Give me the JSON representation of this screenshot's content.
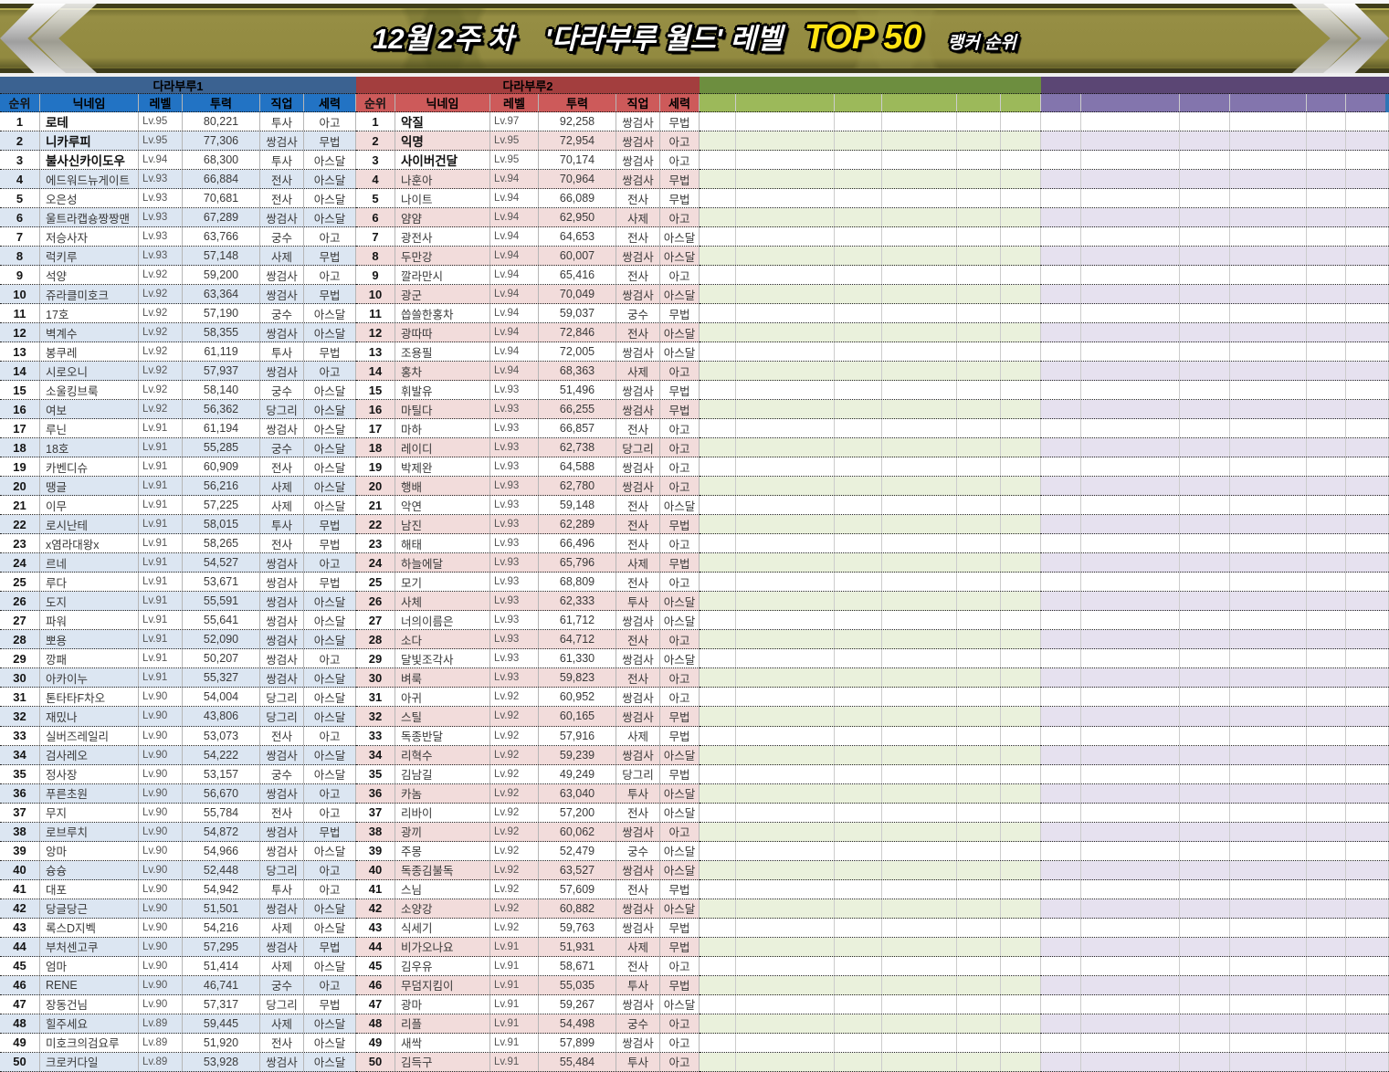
{
  "banner": {
    "week": "12월 2주 차",
    "world": "'다라부루 월드' 레벨",
    "top": "TOP 50",
    "suffix": "랭커 순위",
    "top_color": "#ffe312",
    "bar_color": "#928a40"
  },
  "columns": [
    "순위",
    "닉네임",
    "레벨",
    "투력",
    "직업",
    "세력"
  ],
  "tables": [
    {
      "name": "다라부루1",
      "title_bg": "#3b6291",
      "header_bg": "#2273c4",
      "stripe": "#dce6f2",
      "rows": [
        [
          "1",
          "로테",
          "Lv.95",
          "80,221",
          "투사",
          "아고"
        ],
        [
          "2",
          "니카루피",
          "Lv.95",
          "77,306",
          "쌍검사",
          "무법"
        ],
        [
          "3",
          "불사신카이도우",
          "Lv.94",
          "68,300",
          "투사",
          "아스달"
        ],
        [
          "4",
          "에드워드뉴게이트",
          "Lv.93",
          "66,884",
          "전사",
          "아스달"
        ],
        [
          "5",
          "오은성",
          "Lv.93",
          "70,681",
          "전사",
          "아스달"
        ],
        [
          "6",
          "울트라캡숑짱짱맨",
          "Lv.93",
          "67,289",
          "쌍검사",
          "아스달"
        ],
        [
          "7",
          "저승사자",
          "Lv.93",
          "63,766",
          "궁수",
          "아고"
        ],
        [
          "8",
          "럭키루",
          "Lv.93",
          "57,148",
          "사제",
          "무법"
        ],
        [
          "9",
          "석양",
          "Lv.92",
          "59,200",
          "쌍검사",
          "아고"
        ],
        [
          "10",
          "쥬라클미호크",
          "Lv.92",
          "63,364",
          "쌍검사",
          "무법"
        ],
        [
          "11",
          "17호",
          "Lv.92",
          "57,190",
          "궁수",
          "아스달"
        ],
        [
          "12",
          "벽계수",
          "Lv.92",
          "58,355",
          "쌍검사",
          "아스달"
        ],
        [
          "13",
          "봉쿠레",
          "Lv.92",
          "61,119",
          "투사",
          "무법"
        ],
        [
          "14",
          "시로오니",
          "Lv.92",
          "57,937",
          "쌍검사",
          "아고"
        ],
        [
          "15",
          "소울킹브룩",
          "Lv.92",
          "58,140",
          "궁수",
          "아스달"
        ],
        [
          "16",
          "여보",
          "Lv.92",
          "56,362",
          "당그리",
          "아스달"
        ],
        [
          "17",
          "루닌",
          "Lv.91",
          "61,194",
          "쌍검사",
          "아스달"
        ],
        [
          "18",
          "18호",
          "Lv.91",
          "55,285",
          "궁수",
          "아스달"
        ],
        [
          "19",
          "카벤디슈",
          "Lv.91",
          "60,909",
          "전사",
          "아스달"
        ],
        [
          "20",
          "땡글",
          "Lv.91",
          "56,216",
          "사제",
          "아스달"
        ],
        [
          "21",
          "이무",
          "Lv.91",
          "57,225",
          "사제",
          "아스달"
        ],
        [
          "22",
          "로시난테",
          "Lv.91",
          "58,015",
          "투사",
          "무법"
        ],
        [
          "23",
          "x염라대왕x",
          "Lv.91",
          "58,265",
          "전사",
          "무법"
        ],
        [
          "24",
          "르네",
          "Lv.91",
          "54,527",
          "쌍검사",
          "아고"
        ],
        [
          "25",
          "루다",
          "Lv.91",
          "53,671",
          "쌍검사",
          "무법"
        ],
        [
          "26",
          "도지",
          "Lv.91",
          "55,591",
          "쌍검사",
          "아스달"
        ],
        [
          "27",
          "파워",
          "Lv.91",
          "55,641",
          "쌍검사",
          "아스달"
        ],
        [
          "28",
          "뽀용",
          "Lv.91",
          "52,090",
          "쌍검사",
          "아스달"
        ],
        [
          "29",
          "깡패",
          "Lv.91",
          "50,207",
          "쌍검사",
          "아고"
        ],
        [
          "30",
          "아카이누",
          "Lv.91",
          "55,327",
          "쌍검사",
          "아스달"
        ],
        [
          "31",
          "톤타타F차오",
          "Lv.90",
          "54,004",
          "당그리",
          "아스달"
        ],
        [
          "32",
          "재밌나",
          "Lv.90",
          "43,806",
          "당그리",
          "아스달"
        ],
        [
          "33",
          "실버즈레일리",
          "Lv.90",
          "53,073",
          "전사",
          "아고"
        ],
        [
          "34",
          "검사레오",
          "Lv.90",
          "54,222",
          "쌍검사",
          "아스달"
        ],
        [
          "35",
          "정사장",
          "Lv.90",
          "53,157",
          "궁수",
          "아스달"
        ],
        [
          "36",
          "푸른초원",
          "Lv.90",
          "56,670",
          "쌍검사",
          "아고"
        ],
        [
          "37",
          "무지",
          "Lv.90",
          "55,784",
          "전사",
          "아고"
        ],
        [
          "38",
          "로브루치",
          "Lv.90",
          "54,872",
          "쌍검사",
          "무법"
        ],
        [
          "39",
          "앙마",
          "Lv.90",
          "54,966",
          "쌍검사",
          "아스달"
        ],
        [
          "40",
          "슝슝",
          "Lv.90",
          "52,448",
          "당그리",
          "아고"
        ],
        [
          "41",
          "대포",
          "Lv.90",
          "54,942",
          "투사",
          "아고"
        ],
        [
          "42",
          "당글당근",
          "Lv.90",
          "51,501",
          "쌍검사",
          "아스달"
        ],
        [
          "43",
          "록스D지벡",
          "Lv.90",
          "54,216",
          "사제",
          "아스달"
        ],
        [
          "44",
          "부처센고쿠",
          "Lv.90",
          "57,295",
          "쌍검사",
          "무법"
        ],
        [
          "45",
          "엄마",
          "Lv.90",
          "51,414",
          "사제",
          "아스달"
        ],
        [
          "46",
          "RENE",
          "Lv.90",
          "46,741",
          "궁수",
          "아고"
        ],
        [
          "47",
          "장동건님",
          "Lv.90",
          "57,317",
          "당그리",
          "무법"
        ],
        [
          "48",
          "힐주세요",
          "Lv.89",
          "59,445",
          "사제",
          "아스달"
        ],
        [
          "49",
          "미호크의검요루",
          "Lv.89",
          "51,920",
          "전사",
          "아스달"
        ],
        [
          "50",
          "크로커다일",
          "Lv.89",
          "53,928",
          "쌍검사",
          "아스달"
        ]
      ]
    },
    {
      "name": "다라부루2",
      "title_bg": "#a33e3e",
      "header_bg": "#cd5a5a",
      "stripe": "#f2dcdb",
      "rows": [
        [
          "1",
          "악질",
          "Lv.97",
          "92,258",
          "쌍검사",
          "무법"
        ],
        [
          "2",
          "익명",
          "Lv.95",
          "72,954",
          "쌍검사",
          "아고"
        ],
        [
          "3",
          "사이버건달",
          "Lv.95",
          "70,174",
          "쌍검사",
          "아고"
        ],
        [
          "4",
          "나훈아",
          "Lv.94",
          "70,964",
          "쌍검사",
          "무법"
        ],
        [
          "5",
          "나이트",
          "Lv.94",
          "66,089",
          "전사",
          "무법"
        ],
        [
          "6",
          "얌얌",
          "Lv.94",
          "62,950",
          "사제",
          "아고"
        ],
        [
          "7",
          "광전사",
          "Lv.94",
          "64,653",
          "전사",
          "아스달"
        ],
        [
          "8",
          "두만강",
          "Lv.94",
          "60,007",
          "쌍검사",
          "아스달"
        ],
        [
          "9",
          "깔라만시",
          "Lv.94",
          "65,416",
          "전사",
          "아고"
        ],
        [
          "10",
          "광군",
          "Lv.94",
          "70,049",
          "쌍검사",
          "아스달"
        ],
        [
          "11",
          "씁쓸한홍차",
          "Lv.94",
          "59,037",
          "궁수",
          "무법"
        ],
        [
          "12",
          "광따따",
          "Lv.94",
          "72,846",
          "전사",
          "아스달"
        ],
        [
          "13",
          "조용필",
          "Lv.94",
          "72,005",
          "쌍검사",
          "아스달"
        ],
        [
          "14",
          "홍차",
          "Lv.94",
          "68,363",
          "사제",
          "아고"
        ],
        [
          "15",
          "휘발유",
          "Lv.93",
          "51,496",
          "쌍검사",
          "무법"
        ],
        [
          "16",
          "마틸다",
          "Lv.93",
          "66,255",
          "쌍검사",
          "무법"
        ],
        [
          "17",
          "마하",
          "Lv.93",
          "66,857",
          "전사",
          "아고"
        ],
        [
          "18",
          "레이디",
          "Lv.93",
          "62,738",
          "당그리",
          "아고"
        ],
        [
          "19",
          "박제완",
          "Lv.93",
          "64,588",
          "쌍검사",
          "아고"
        ],
        [
          "20",
          "행배",
          "Lv.93",
          "62,780",
          "쌍검사",
          "아고"
        ],
        [
          "21",
          "악연",
          "Lv.93",
          "59,148",
          "전사",
          "아스달"
        ],
        [
          "22",
          "남진",
          "Lv.93",
          "62,289",
          "전사",
          "무법"
        ],
        [
          "23",
          "해태",
          "Lv.93",
          "66,496",
          "전사",
          "아고"
        ],
        [
          "24",
          "하늘에달",
          "Lv.93",
          "65,796",
          "사제",
          "무법"
        ],
        [
          "25",
          "모기",
          "Lv.93",
          "68,809",
          "전사",
          "아고"
        ],
        [
          "26",
          "사체",
          "Lv.93",
          "62,333",
          "투사",
          "아스달"
        ],
        [
          "27",
          "너의이름은",
          "Lv.93",
          "61,712",
          "쌍검사",
          "아스달"
        ],
        [
          "28",
          "소다",
          "Lv.93",
          "64,712",
          "전사",
          "아고"
        ],
        [
          "29",
          "달빛조각사",
          "Lv.93",
          "61,330",
          "쌍검사",
          "아스달"
        ],
        [
          "30",
          "벼룩",
          "Lv.93",
          "59,823",
          "전사",
          "아고"
        ],
        [
          "31",
          "아귀",
          "Lv.92",
          "60,952",
          "쌍검사",
          "아고"
        ],
        [
          "32",
          "스틸",
          "Lv.92",
          "60,165",
          "쌍검사",
          "무법"
        ],
        [
          "33",
          "독종반달",
          "Lv.92",
          "57,916",
          "사제",
          "무법"
        ],
        [
          "34",
          "리혁수",
          "Lv.92",
          "59,239",
          "쌍검사",
          "아스달"
        ],
        [
          "35",
          "김남길",
          "Lv.92",
          "49,249",
          "당그리",
          "무법"
        ],
        [
          "36",
          "카놈",
          "Lv.92",
          "63,040",
          "투사",
          "아스달"
        ],
        [
          "37",
          "리바이",
          "Lv.92",
          "57,200",
          "전사",
          "아스달"
        ],
        [
          "38",
          "광끼",
          "Lv.92",
          "60,062",
          "쌍검사",
          "아고"
        ],
        [
          "39",
          "주몽",
          "Lv.92",
          "52,479",
          "궁수",
          "아스달"
        ],
        [
          "40",
          "독종김불독",
          "Lv.92",
          "63,527",
          "쌍검사",
          "아스달"
        ],
        [
          "41",
          "스님",
          "Lv.92",
          "57,609",
          "전사",
          "무법"
        ],
        [
          "42",
          "소양강",
          "Lv.92",
          "60,882",
          "쌍검사",
          "아스달"
        ],
        [
          "43",
          "식세기",
          "Lv.92",
          "59,763",
          "쌍검사",
          "무법"
        ],
        [
          "44",
          "비가오나요",
          "Lv.91",
          "51,931",
          "사제",
          "무법"
        ],
        [
          "45",
          "김우유",
          "Lv.91",
          "58,671",
          "전사",
          "아고"
        ],
        [
          "46",
          "무덤지킴이",
          "Lv.91",
          "55,035",
          "투사",
          "무법"
        ],
        [
          "47",
          "광마",
          "Lv.91",
          "59,267",
          "쌍검사",
          "아스달"
        ],
        [
          "48",
          "리플",
          "Lv.91",
          "54,498",
          "궁수",
          "아고"
        ],
        [
          "49",
          "새싹",
          "Lv.91",
          "57,899",
          "쌍검사",
          "아고"
        ],
        [
          "50",
          "김득구",
          "Lv.91",
          "55,484",
          "투사",
          "아고"
        ]
      ]
    }
  ],
  "empty_tables": [
    {
      "title_bg": "#6d8e3f",
      "header_bg": "#9cb95a",
      "stripe": "#eaf1dc",
      "row_count": 50
    },
    {
      "title_bg": "#5b4674",
      "header_bg": "#8375ad",
      "stripe": "#e6e1ef",
      "row_count": 50
    }
  ]
}
